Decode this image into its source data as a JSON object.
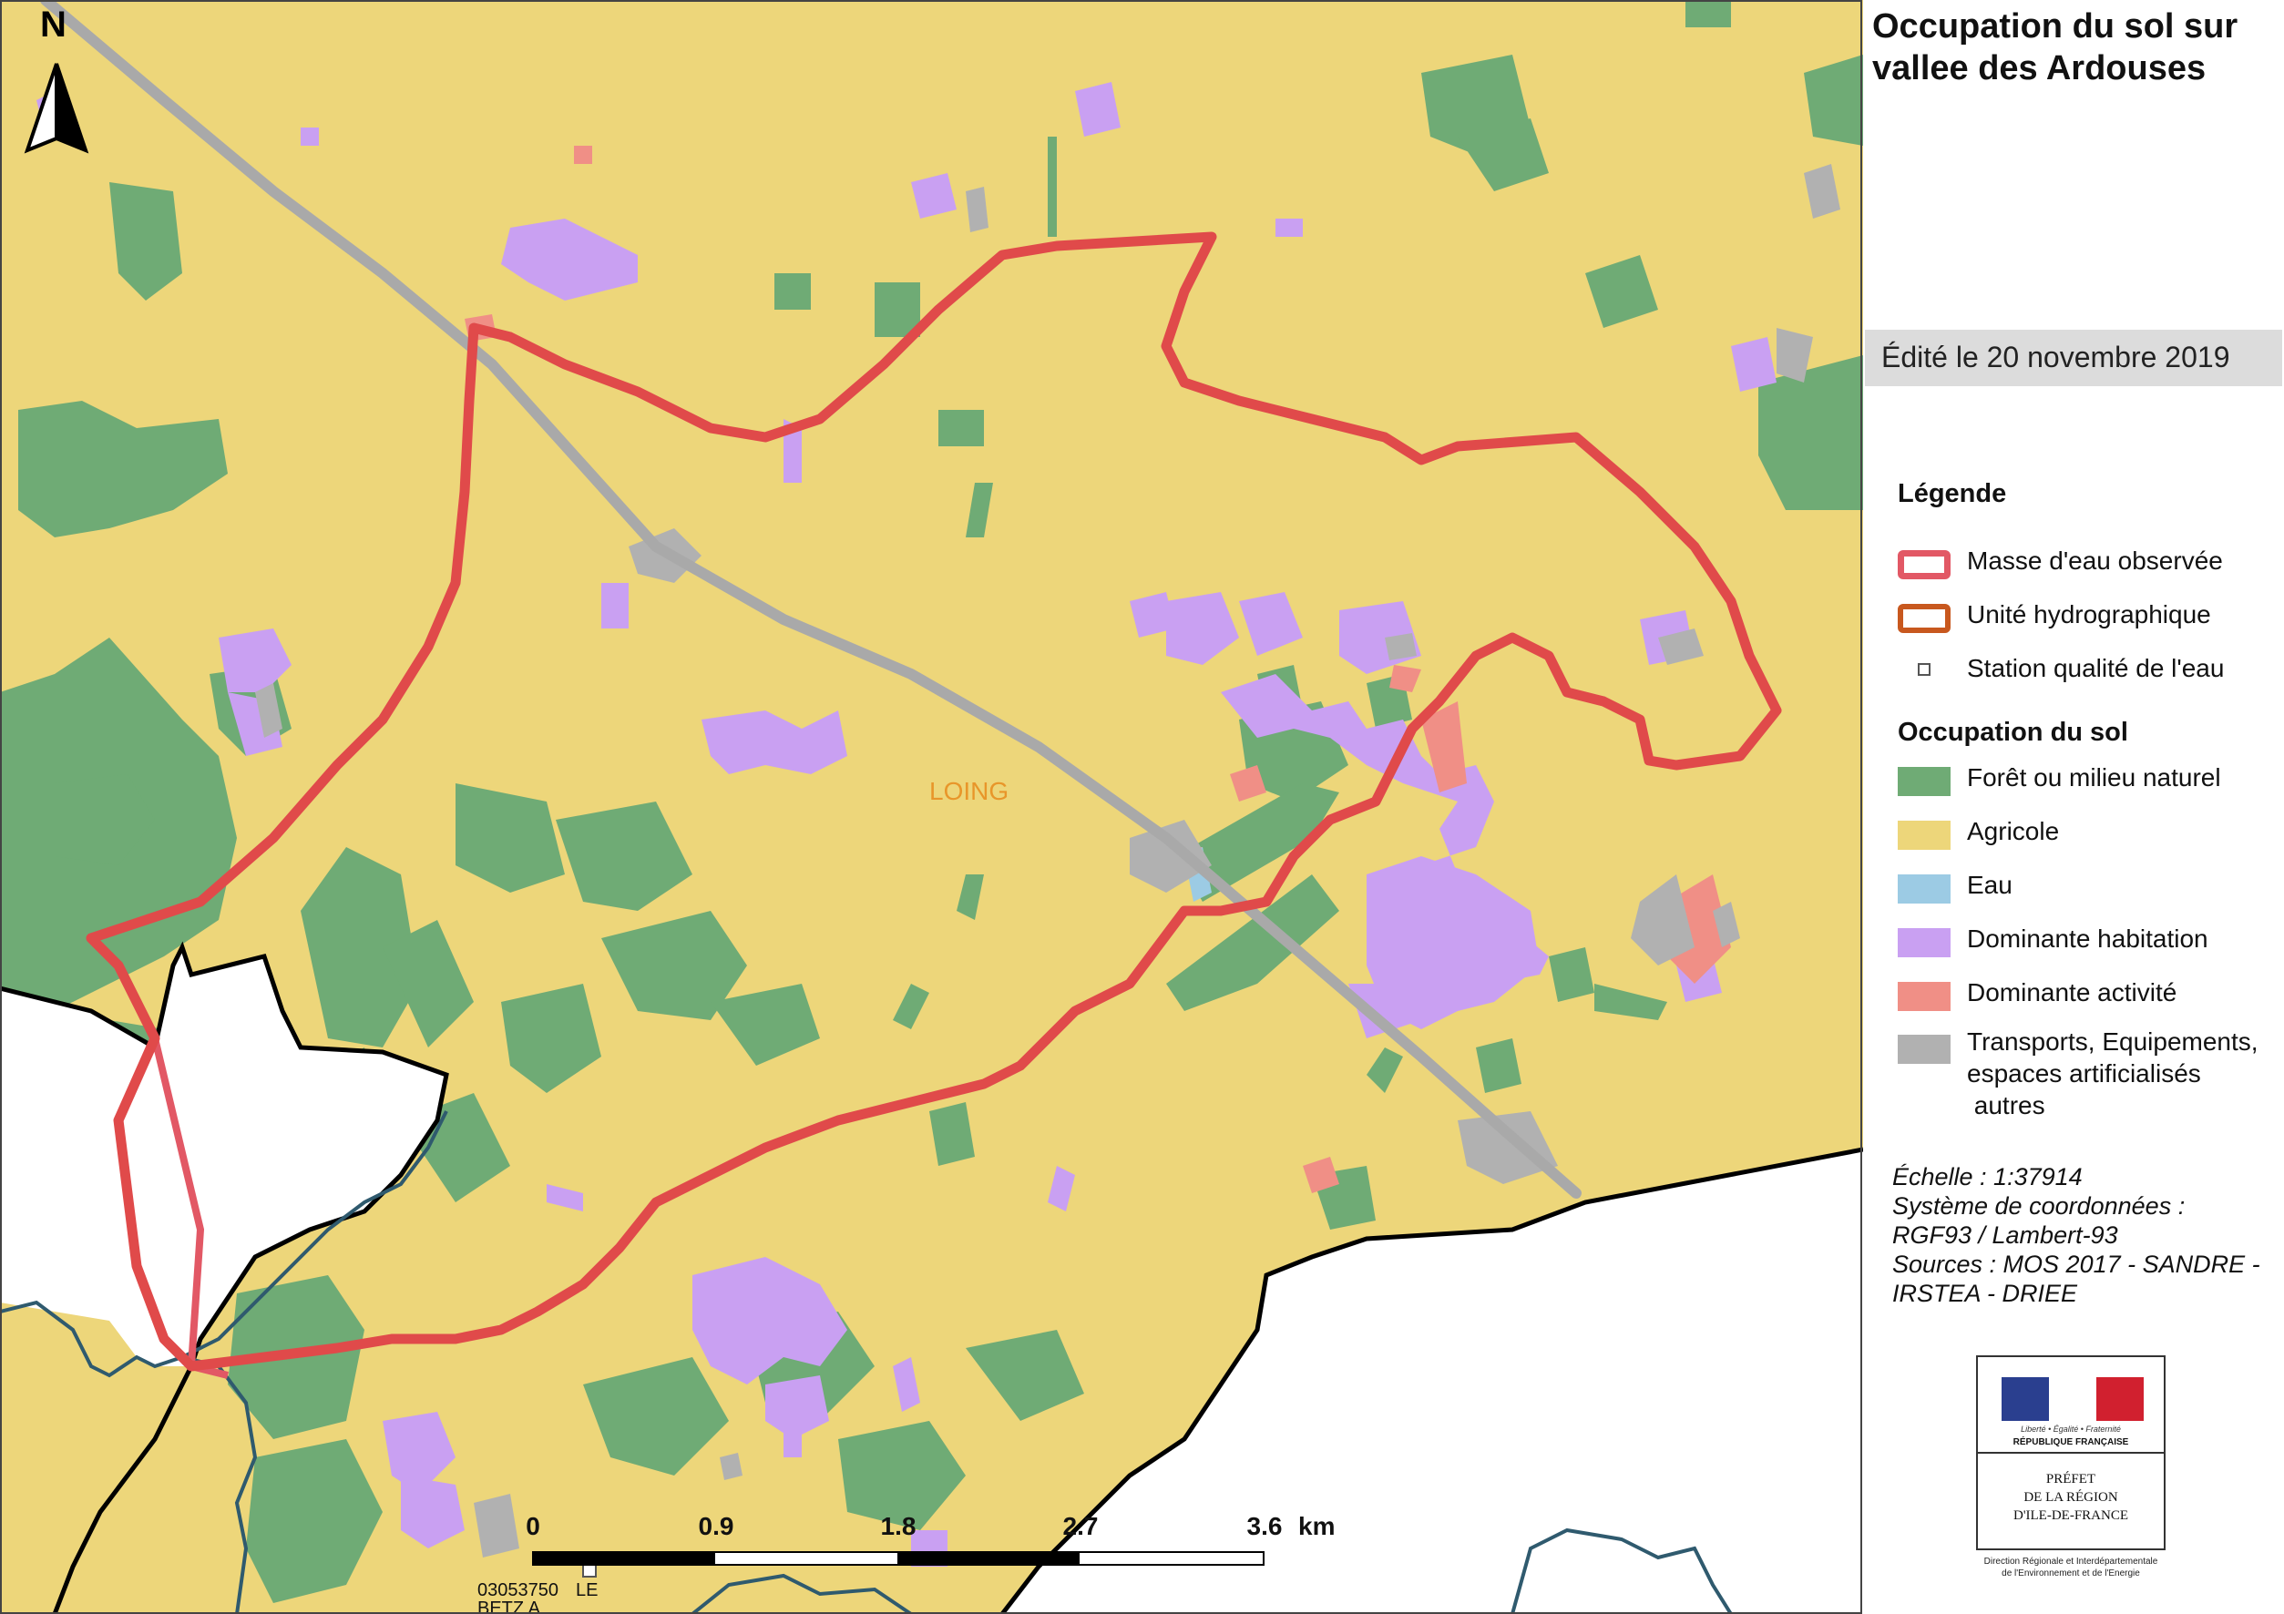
{
  "map": {
    "title_line1": "Occupation du sol sur",
    "title_line2": "vallee des Ardouses",
    "edition": "Édité le 20 novembre 2019",
    "north": "N",
    "river_label": "LOING",
    "station_code": "03053750",
    "station_name_line1": "LE",
    "station_name_line2": "BETZ A",
    "scale_ticks": [
      "0",
      "0.9",
      "1.8",
      "2.7",
      "3.6"
    ],
    "scale_unit": "km"
  },
  "legend": {
    "title": "Légende",
    "hydro_items": [
      {
        "label": "Masse d'eau observée",
        "color": "#e25865",
        "symbol": "outline"
      },
      {
        "label": "Unité hydrographique",
        "color": "#c8581e",
        "symbol": "outline"
      },
      {
        "label": "Station qualité de l'eau",
        "color": "#555555",
        "symbol": "square"
      }
    ],
    "landuse_title": "Occupation du sol",
    "landuse_items": [
      {
        "label": "Forêt ou milieu naturel",
        "color": "#6fab75"
      },
      {
        "label": "Agricole",
        "color": "#edd67a"
      },
      {
        "label": "Eau",
        "color": "#9ccbe4"
      },
      {
        "label": "Dominante habitation",
        "color": "#c9a0f2"
      },
      {
        "label": "Dominante activité",
        "color": "#f08f86"
      },
      {
        "label": "Transports, Equipements, espaces artificialisés autres",
        "label_lines": [
          "Transports, Equipements,",
          "espaces artificialisés",
          " autres"
        ],
        "color": "#b1b1b1"
      }
    ]
  },
  "metadata": {
    "scale_label": "Échelle :  1:37914",
    "crs_line1": "Système de coordonnées :",
    "crs_line2": "RGF93 / Lambert-93",
    "sources_line1": "Sources : MOS 2017 - SANDRE -",
    "sources_line2": "IRSTEA - DRIEE"
  },
  "logo": {
    "motto": "Liberté • Égalité • Fraternité",
    "republique": "RÉPUBLIQUE FRANÇAISE",
    "prefet_line1": "PRÉFET",
    "prefet_line2": "DE LA RÉGION",
    "prefet_line3": "D'ILE-DE-FRANCE",
    "direction_line1": "Direction Régionale et Interdépartementale",
    "direction_line2": "de l'Environnement et de l'Energie",
    "colors": {
      "blue": "#2a3f8f",
      "white": "#ffffff",
      "red": "#d1202f"
    }
  },
  "colors": {
    "agricole": "#edd67a",
    "foret": "#6fab75",
    "habitation": "#c9a0f2",
    "activite": "#f08f86",
    "eau": "#9ccbe4",
    "transport": "#b1b1b1",
    "masse_eau": "#e25865",
    "river_line": "#2f5a6e",
    "boundary": "#000000",
    "river_label": "#e8962a"
  }
}
